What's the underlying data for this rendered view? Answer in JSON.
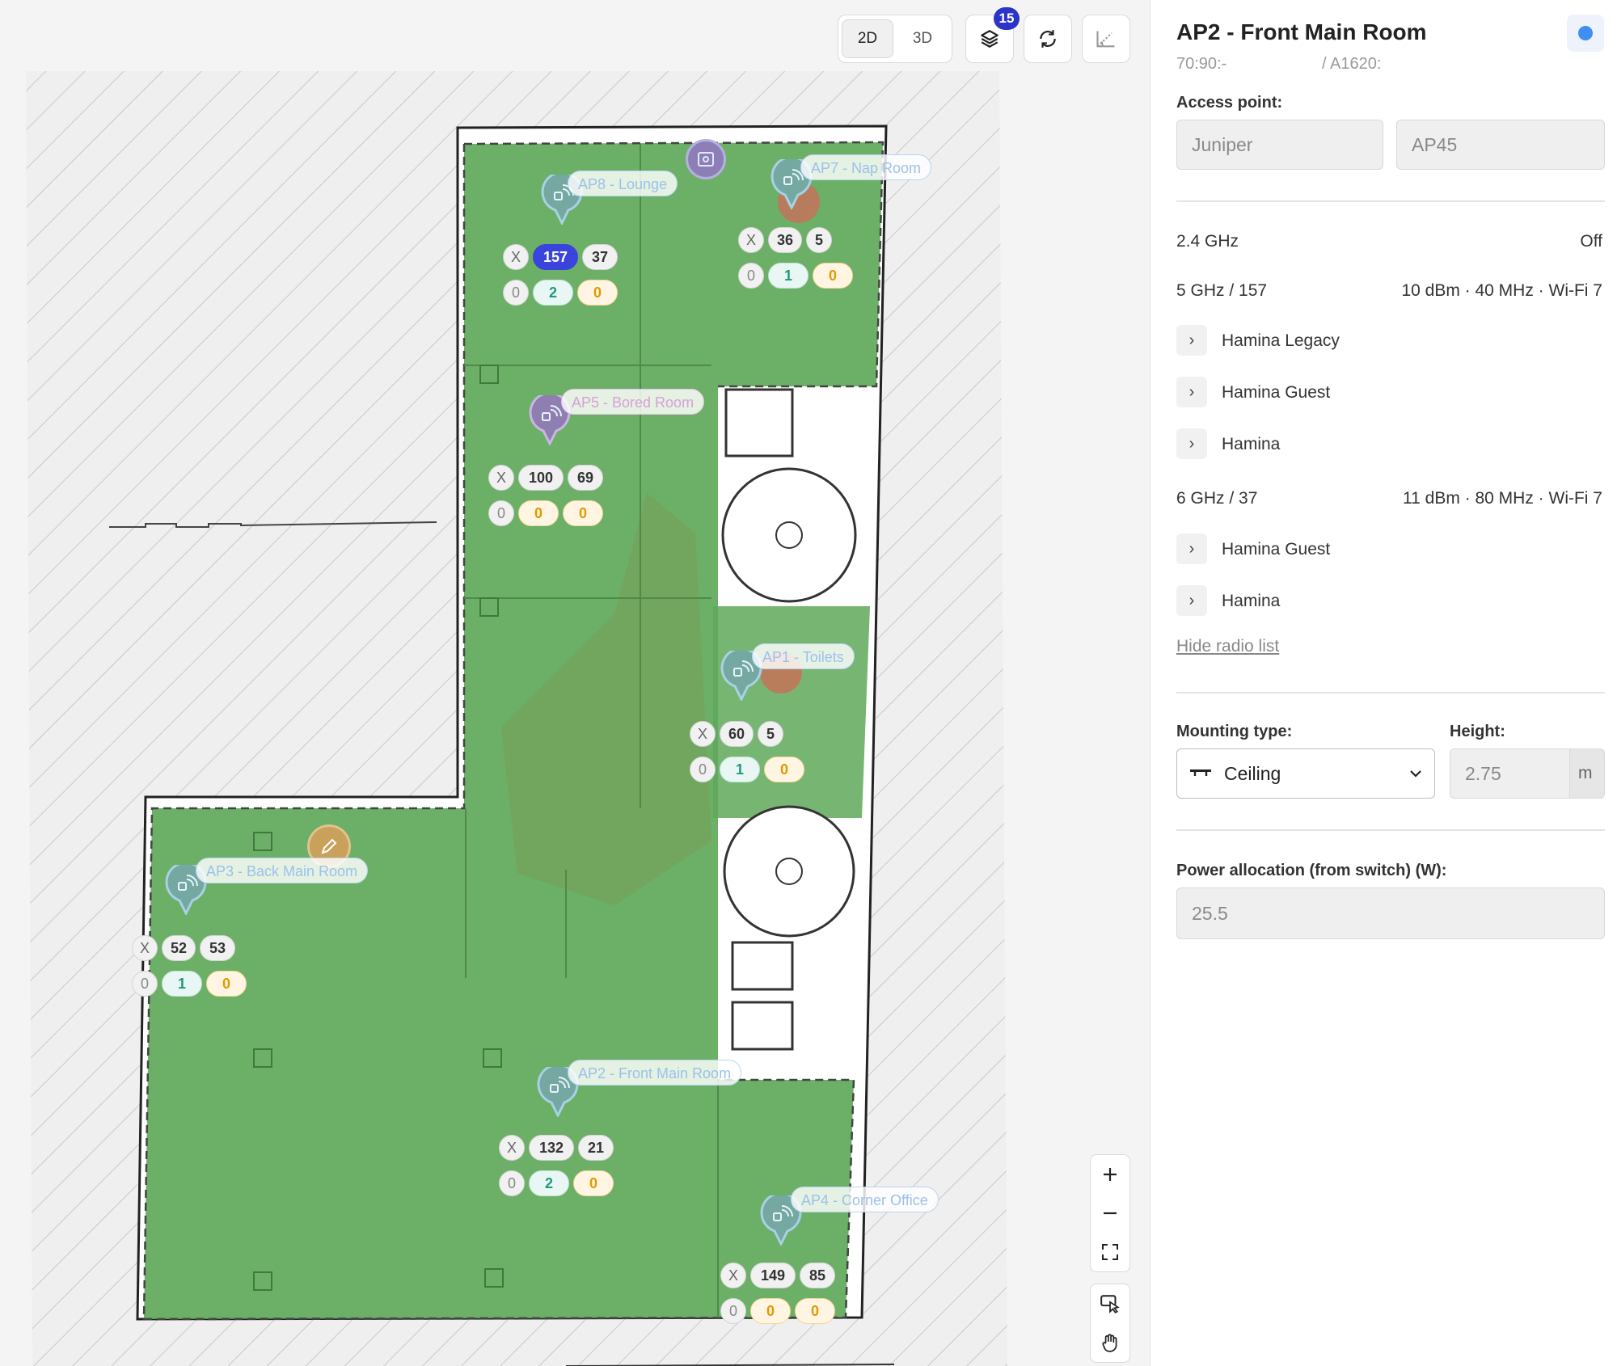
{
  "toolbar": {
    "view_2d": "2D",
    "view_3d": "3D",
    "layers_badge": "15"
  },
  "map": {
    "access_points": [
      {
        "label": "AP8 - Lounge",
        "color": "blue",
        "channel_5": "157",
        "channel_6": "37",
        "counts": [
          "0",
          "2",
          "0"
        ]
      },
      {
        "label": "AP7 - Nap Room",
        "color": "blue",
        "channel_5": "36",
        "channel_6": "5",
        "counts": [
          "0",
          "1",
          "0"
        ]
      },
      {
        "label": "AP5 - Bored Room",
        "color": "pink",
        "channel_5": "100",
        "channel_6": "69",
        "counts": [
          "0",
          "0",
          "0"
        ]
      },
      {
        "label": "AP1 - Toilets",
        "color": "blue",
        "channel_5": "60",
        "channel_6": "5",
        "counts": [
          "0",
          "1",
          "0"
        ]
      },
      {
        "label": "AP3 - Back Main Room",
        "color": "blue",
        "channel_5": "52",
        "channel_6": "53",
        "counts": [
          "0",
          "1",
          "0"
        ]
      },
      {
        "label": "AP2 - Front Main Room",
        "color": "blue",
        "channel_5": "132",
        "channel_6": "21",
        "counts": [
          "0",
          "2",
          "0"
        ]
      },
      {
        "label": "AP4 - Corner Office",
        "color": "blue",
        "channel_5": "149",
        "channel_6": "85",
        "counts": [
          "0",
          "0",
          "0"
        ]
      }
    ],
    "disabled_label": "X",
    "zoom_controls": [
      "zoom-in",
      "zoom-out",
      "fit-to-screen"
    ],
    "tool_controls": [
      "select-tool",
      "pan-tool"
    ]
  },
  "panel": {
    "title": "AP2 - Front Main Room",
    "mac_prefix": "70:90:-",
    "serial_suffix": "/ A1620:",
    "access_point_label": "Access point:",
    "vendor": "Juniper",
    "model": "AP45",
    "band_24": {
      "label": "2.4 GHz",
      "value": "Off"
    },
    "band_5": {
      "label": "5 GHz / 157",
      "value": "10 dBm · 40 MHz · Wi-Fi 7",
      "ssids": [
        "Hamina Legacy",
        "Hamina Guest",
        "Hamina"
      ]
    },
    "band_6": {
      "label": "6 GHz / 37",
      "value": "11 dBm · 80 MHz · Wi-Fi 7",
      "ssids": [
        "Hamina Guest",
        "Hamina"
      ]
    },
    "hide_radio_list": "Hide radio list",
    "mounting_label": "Mounting type:",
    "mounting_value": "Ceiling",
    "height_label": "Height:",
    "height_value": "2.75",
    "height_unit": "m",
    "power_label": "Power allocation (from switch) (W):",
    "power_value": "25.5"
  },
  "colors": {
    "coverage_green": "#5fa85a",
    "accent_blue": "#3a44dc",
    "status_dot": "#3f8ff2"
  }
}
